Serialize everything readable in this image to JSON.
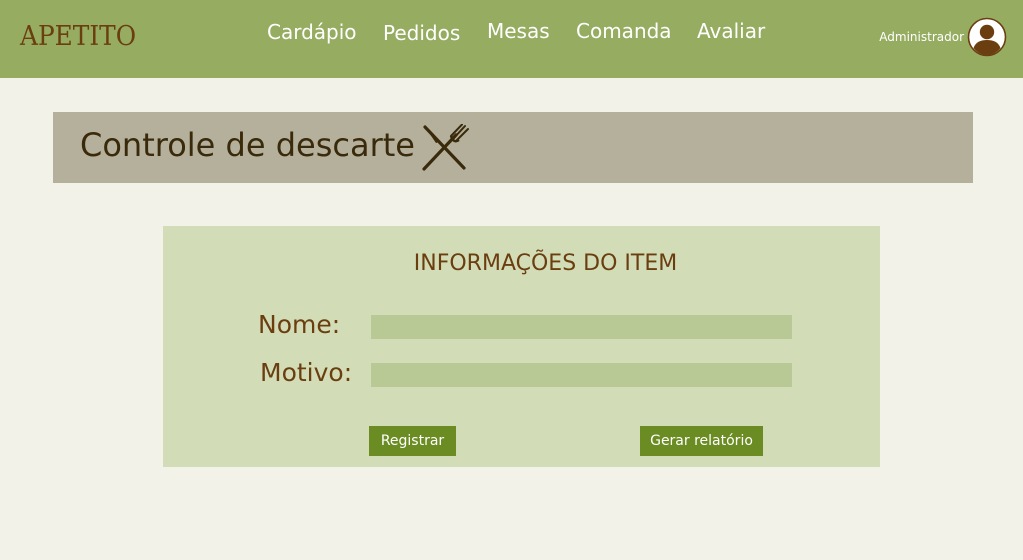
{
  "header": {
    "logo": "APETITO",
    "nav": [
      "Cardápio",
      "Pedidos",
      "Mesas",
      "Comanda",
      "Avaliar"
    ],
    "user_label": "Administrador"
  },
  "page": {
    "title": "Controle de descarte"
  },
  "form": {
    "title": "INFORMAÇÕES DO ITEM",
    "name_label": "Nome:",
    "name_value": "",
    "reason_label": "Motivo:",
    "reason_value": "",
    "register_button": "Registrar",
    "report_button": "Gerar relatório"
  },
  "colors": {
    "navbar": "#96ad61",
    "background": "#f2f2e8",
    "title_bar": "#b5b09c",
    "card": "#d2ddb8",
    "input": "#b9c995",
    "button": "#6a8c22",
    "brown": "#6b3e10"
  },
  "icons": {
    "avatar": "user-avatar-icon",
    "title_icon": "fork-knife-crossed-icon"
  }
}
